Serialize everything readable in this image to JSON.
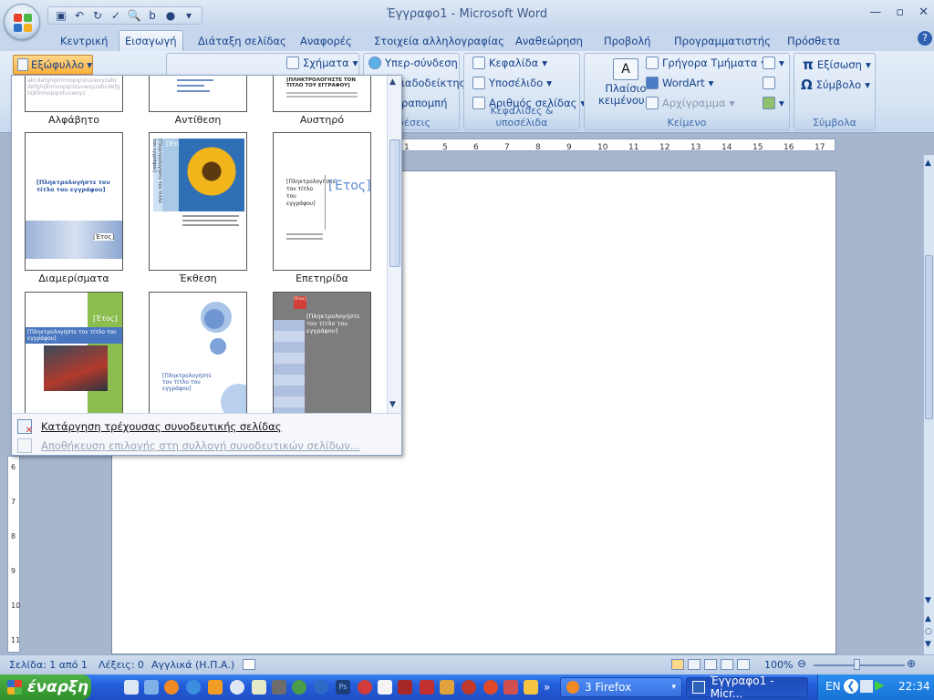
{
  "window": {
    "title": "Έγγραφο1 - Microsoft Word"
  },
  "tabs": [
    "Κεντρική",
    "Εισαγωγή",
    "Διάταξη σελίδας",
    "Αναφορές",
    "Στοιχεία αλληλογραφίας",
    "Αναθεώρηση",
    "Προβολή",
    "Προγραμματιστής",
    "Πρόσθετα"
  ],
  "active_tab": "Εισαγωγή",
  "ribbon": {
    "cover_page_button": "Εξώφυλλο",
    "shapes": "Σχήματα",
    "hyperlink": "Υπερ-σύνδεση",
    "bookmark": "ιαδοδείκτης",
    "cross_reference": "ραπομπή",
    "links_group": "νδέσεις",
    "header": "Κεφαλίδα",
    "footer": "Υποσέλιδο",
    "page_number": "Αριθμός σελίδας",
    "header_footer_group": "Κεφαλίδες & υποσέλιδα",
    "textbox": [
      "Πλαίσιο",
      "κειμένου"
    ],
    "quick_parts": "Γρήγορα Τμήματα",
    "wordart": "WordArt",
    "dropcap": "Αρχίγραμμα",
    "text_group": "Κείμενο",
    "equation": "Εξίσωση",
    "symbol": "Σύμβολο",
    "symbols_group": "Σύμβολα"
  },
  "gallery": {
    "covers": [
      {
        "name": "Αλφάβητο"
      },
      {
        "name": "Αντίθεση"
      },
      {
        "name": "Αυστηρό",
        "text": "[ΠΛΗΚΤΡΟΛΟΓΗΣΤΕ ΤΟΝ ΤΙΤΛΟ ΤΟΥ ΕΓΓΡΑΦΟΥ]"
      },
      {
        "name": "Διαμερίσματα",
        "title": "[Πληκτρολογήστε τον τίτλο του εγγράφου]",
        "year": "[Έτος]"
      },
      {
        "name": "Έκθεση",
        "side": "[Πληκτρολογήστε τον τίτλο του εγγράφου]",
        "year": "[Έτος]"
      },
      {
        "name": "Επετηρίδα",
        "title": "[Πληκτρολογήστε τον τίτλο του εγγράφου]",
        "year": "[Έτος]"
      },
      {
        "name": "",
        "year": "[Έτος]",
        "title": "[Πληκτρολογήστε τον τίτλο του εγγράφου]"
      },
      {
        "name": "",
        "title": "[Πληκτρολογήστε τον τίτλο του εγγράφου]"
      },
      {
        "name": "",
        "year": "[Έτος]",
        "title": "[Πληκτρολογήστε τον τίτλο του εγγράφου]"
      }
    ],
    "remove": "Κατάργηση τρέχουσας συνοδευτικής σελίδας",
    "save": "Αποθήκευση επιλογής στη συλλογή συνοδευτικών σελίδων..."
  },
  "ruler_numbers": [
    "1",
    "5",
    "6",
    "7",
    "8",
    "9",
    "10",
    "11",
    "12",
    "13",
    "14",
    "15",
    "16",
    "17"
  ],
  "vruler_numbers": [
    "6",
    "7",
    "8",
    "9",
    "10",
    "11"
  ],
  "status": {
    "page": "Σελίδα: 1 από 1",
    "words": "Λέξεις: 0",
    "language": "Αγγλικά (Η.Π.Α.)",
    "zoom": "100%"
  },
  "taskbar": {
    "start": "έναρξη",
    "tasks": [
      "3 Firefox",
      "Έγγραφο1 - Micr..."
    ],
    "lang": "EN",
    "time": "22:34"
  },
  "colors": {
    "accent": "#15428b",
    "ribbon": "#d7e4f3",
    "taskbar": "#245edb",
    "start": "#3a9a35"
  }
}
